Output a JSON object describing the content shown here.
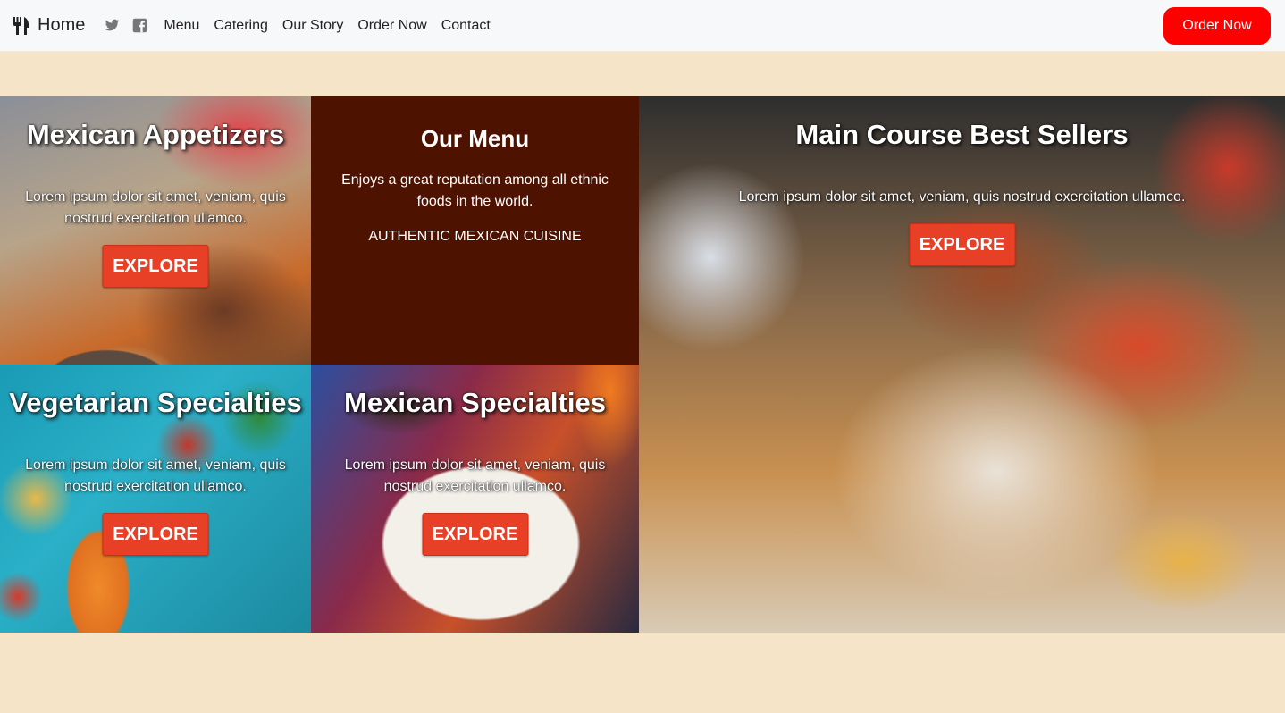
{
  "navbar": {
    "brand_label": "Home",
    "brand_icon": "fork-knife-icon",
    "social_icons": [
      "twitter-icon",
      "facebook-icon"
    ],
    "links": [
      "Menu",
      "Catering",
      "Our Story",
      "Order Now",
      "Contact"
    ],
    "order_button": "Order Now",
    "colors": {
      "order_button": "#ff0000",
      "background": "#f7f8fa"
    }
  },
  "tiles": {
    "appetizers": {
      "title": "Mexican Appetizers",
      "text": "Lorem ipsum dolor sit amet, veniam, quis nostrud exercitation ullamco.",
      "button": "EXPLORE"
    },
    "menu": {
      "title": "Our Menu",
      "description": "Enjoys a great reputation among all ethnic foods in the world.",
      "subtitle": "AUTHENTIC MEXICAN CUISINE"
    },
    "vegetarian": {
      "title": "Vegetarian Specialties",
      "text": "Lorem ipsum dolor sit amet, veniam, quis nostrud exercitation ullamco.",
      "button": "EXPLORE"
    },
    "specialties": {
      "title": "Mexican Specialties",
      "text": "Lorem ipsum dolor sit amet, veniam, quis nostrud exercitation ullamco.",
      "button": "EXPLORE"
    },
    "main_course": {
      "title": "Main Course Best Sellers",
      "text": "Lorem ipsum dolor sit amet, veniam, quis nostrud exercitation ullamco.",
      "button": "EXPLORE"
    }
  },
  "colors": {
    "page_background": "#f5e4c8",
    "menu_tile": "#4d1200",
    "explore_button": "#e84027"
  }
}
